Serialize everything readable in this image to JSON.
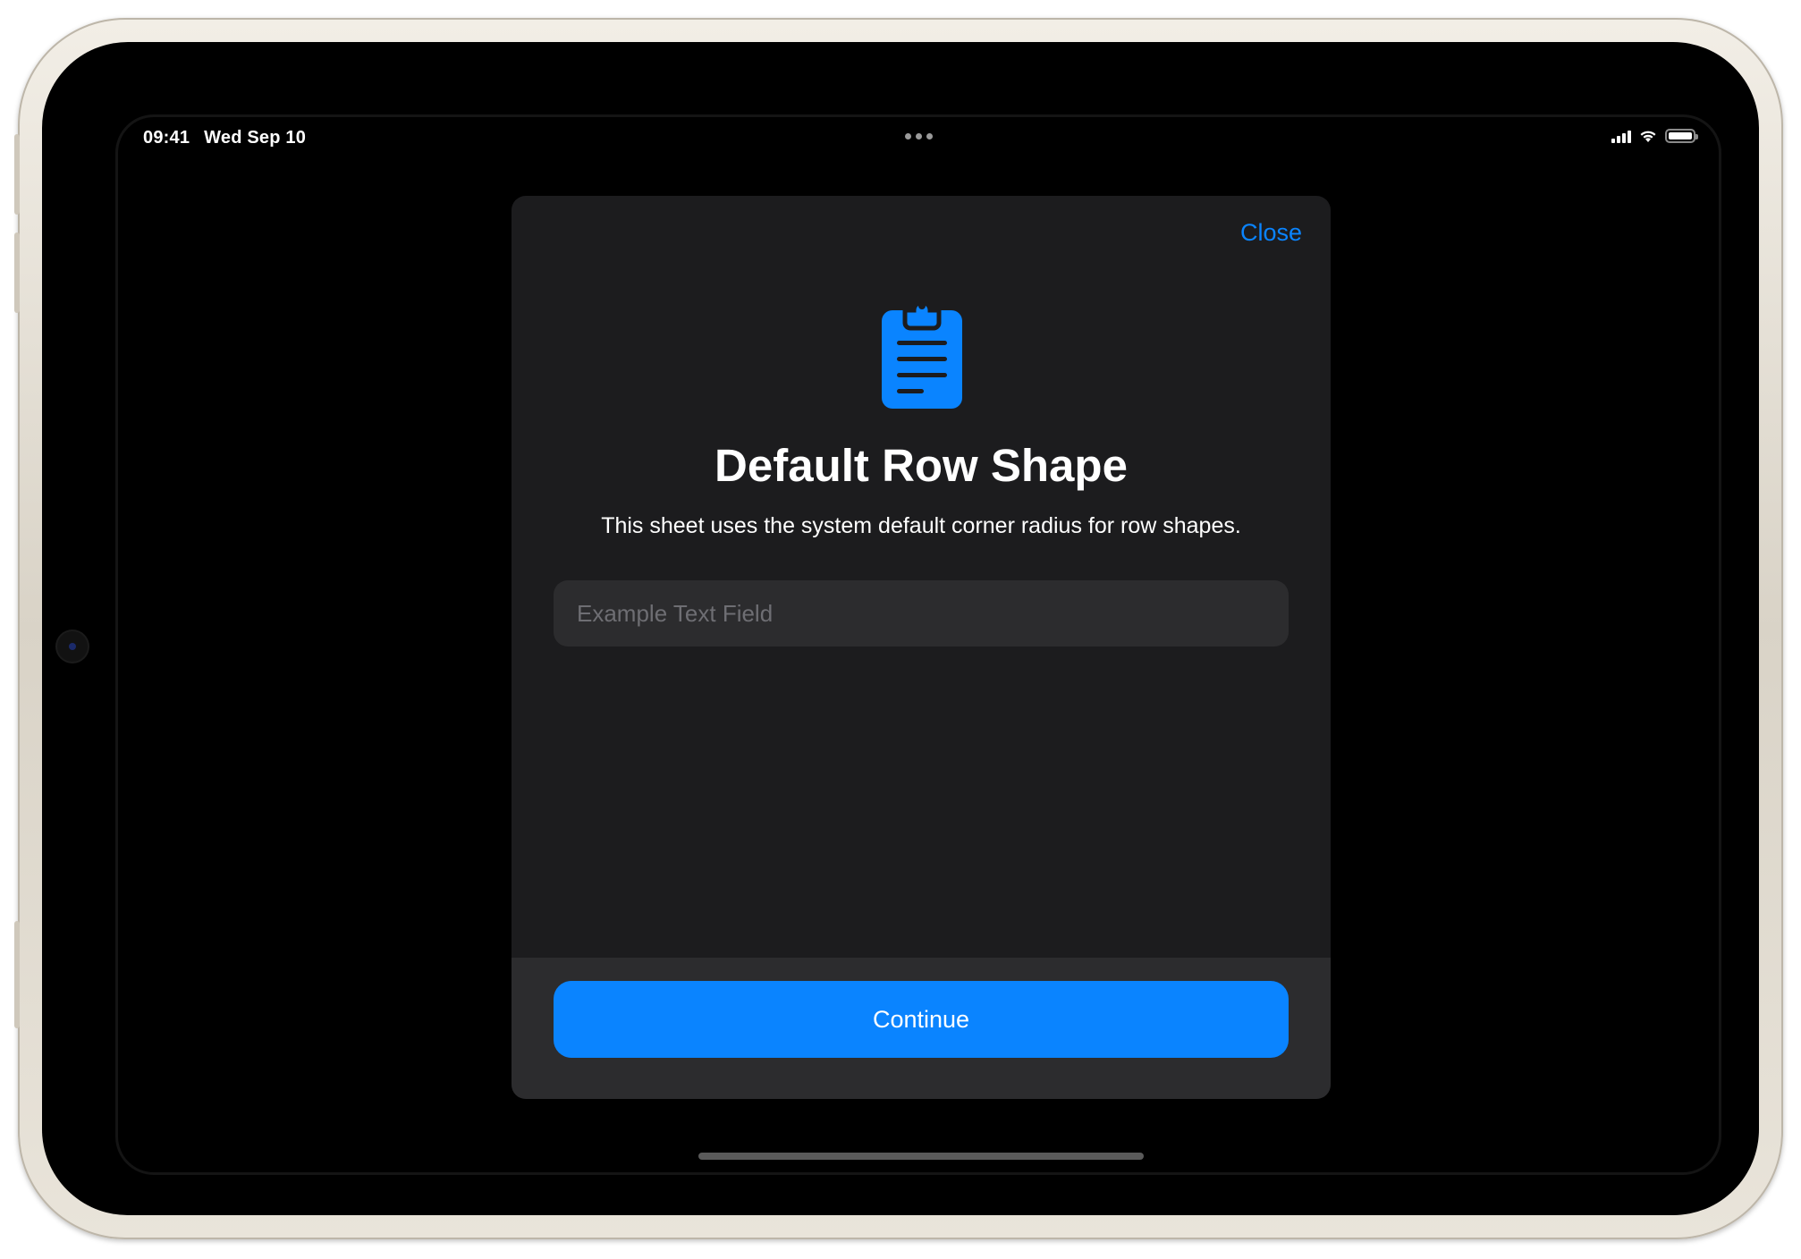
{
  "status_bar": {
    "time": "09:41",
    "date": "Wed Sep 10"
  },
  "sheet": {
    "close_label": "Close",
    "icon": "clipboard-icon",
    "title": "Default Row Shape",
    "subtitle": "This sheet uses the system default corner radius for row shapes.",
    "text_field": {
      "placeholder": "Example Text Field",
      "value": ""
    },
    "continue_label": "Continue"
  },
  "colors": {
    "accent": "#0a84ff",
    "sheet_background": "#1c1c1e",
    "field_background": "#2c2c2e",
    "screen_background": "#000000",
    "device_frame": "#e9e4da"
  }
}
